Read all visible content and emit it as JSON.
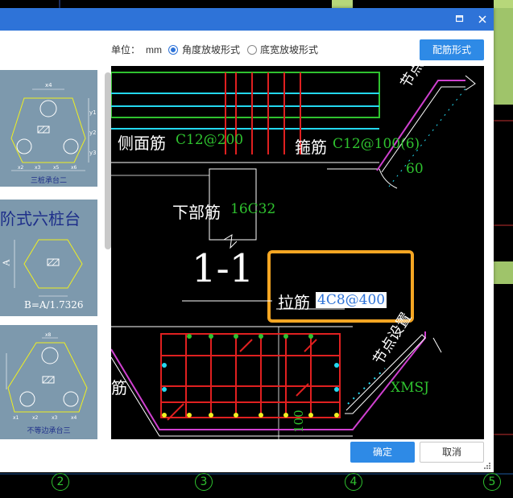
{
  "dialog": {
    "title": "",
    "maximize_icon": "maximize-icon",
    "close_icon": "close-icon"
  },
  "toolbar": {
    "unit_label": "单位：",
    "unit_value": "mm",
    "option_angle": "角度放坡形式",
    "option_width": "底宽放坡形式",
    "selected_option": "角度放坡形式",
    "rebar_form_button": "配筋形式"
  },
  "thumbnails": [
    {
      "caption": "三桩承台二",
      "dims": {
        "x1": "x4",
        "y1": "y1",
        "y2": "y2",
        "y3": "y3",
        "x2": "x2",
        "x3": "x3",
        "x5": "x5",
        "x6": "x6"
      }
    },
    {
      "caption": "阶式六桩台",
      "label_a": "A",
      "formula": "B=A/1.7326"
    },
    {
      "caption": "不等边承台三",
      "dims": {
        "x8": "x8",
        "x1": "x1",
        "x2": "x2",
        "x3": "x3",
        "x4": "x4"
      }
    }
  ],
  "drawing": {
    "side_rebar_label": "侧面筋",
    "side_rebar_value": "C12@200",
    "stirrup_label": "箍筋",
    "stirrup_value": "C12@100(6)",
    "bottom_rebar_label": "下部筋",
    "bottom_rebar_value": "16C32",
    "angle_value": "60",
    "section_label": "1-1",
    "tie_rebar_label": "拉筋",
    "tie_rebar_value": "4C8@400",
    "node_label_top": "节点",
    "node_label_bottom": "节点设置",
    "xmsj_label": "XMSJ",
    "left_rebar_fragment": "筋",
    "bottom_number_fragment": "100"
  },
  "footer": {
    "confirm": "确定",
    "cancel": "取消"
  },
  "axis_labels": [
    "2",
    "3",
    "4",
    "5"
  ],
  "colors": {
    "accent": "#2e73d8",
    "highlight_box": "#f5a623",
    "cad_green": "#2fc22f",
    "rebar_red": "#e02020"
  }
}
